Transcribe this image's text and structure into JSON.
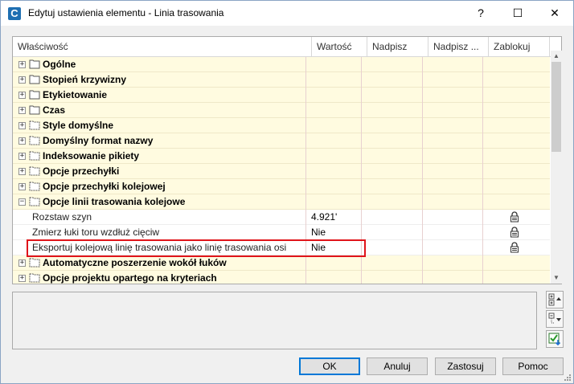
{
  "window": {
    "title": "Edytuj ustawienia elementu - Linia trasowania",
    "app_icon_letter": "C",
    "help_glyph": "?",
    "maximize_glyph": "☐",
    "close_glyph": "✕"
  },
  "grid": {
    "columns": [
      "Właściwość",
      "Wartość",
      "Nadpisz",
      "Nadpisz ...",
      "Zablokuj"
    ],
    "rows": [
      {
        "label": "Ogólne",
        "expander": "+",
        "icon": "folder"
      },
      {
        "label": "Stopień krzywizny",
        "expander": "+",
        "icon": "folder"
      },
      {
        "label": "Etykietowanie",
        "expander": "+",
        "icon": "folder"
      },
      {
        "label": "Czas",
        "expander": "+",
        "icon": "folder"
      },
      {
        "label": "Style domyślne",
        "expander": "+",
        "icon": "dashed-folder"
      },
      {
        "label": "Domyślny format nazwy",
        "expander": "+",
        "icon": "dashed-folder"
      },
      {
        "label": "Indeksowanie pikiety",
        "expander": "+",
        "icon": "dashed-folder"
      },
      {
        "label": "Opcje przechyłki",
        "expander": "+",
        "icon": "dashed-folder"
      },
      {
        "label": "Opcje przechyłki kolejowej",
        "expander": "+",
        "icon": "dashed-folder"
      },
      {
        "label": "Opcje linii trasowania kolejowe",
        "expander": "−",
        "icon": "dashed-folder"
      }
    ],
    "subrows": [
      {
        "label": "Rozstaw szyn",
        "value": "4.921'",
        "locked": true
      },
      {
        "label": "Zmierz łuki toru wzdłuż cięciw",
        "value": "Nie",
        "locked": true
      },
      {
        "label": "Eksportuj kolejową linię trasowania jako linię trasowania osi",
        "value": "Nie",
        "locked": true
      }
    ],
    "rows_after": [
      {
        "label": "Automatyczne poszerzenie wokół łuków",
        "expander": "+",
        "icon": "dashed-folder"
      },
      {
        "label": "Opcje projektu opartego na kryteriach",
        "expander": "+",
        "icon": "dashed-folder"
      }
    ]
  },
  "scrollbar": {
    "up_glyph": "▲",
    "down_glyph": "▼"
  },
  "buttons": {
    "ok": "OK",
    "cancel": "Anuluj",
    "apply": "Zastosuj",
    "help": "Pomoc"
  },
  "colors": {
    "highlight_border": "#e0141a",
    "row_bg": "#fffbe0",
    "default_button_border": "#0078d7"
  }
}
